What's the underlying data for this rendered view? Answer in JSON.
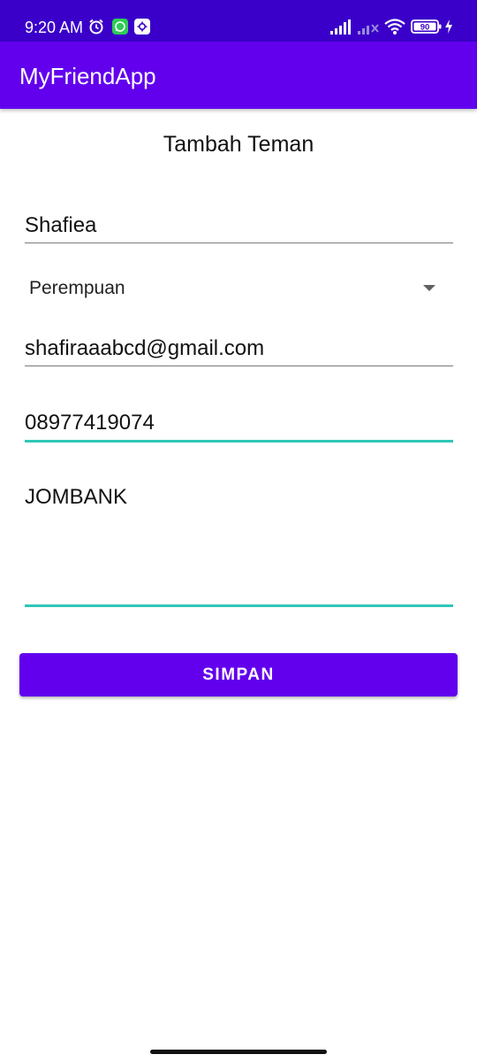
{
  "status_bar": {
    "time": "9:20 AM",
    "battery_level": "90",
    "icons": [
      "alarm-icon",
      "whatsapp-icon",
      "app-notification-icon",
      "signal-icon",
      "signal-no-service-icon",
      "wifi-icon",
      "battery-icon",
      "charging-icon"
    ]
  },
  "app_bar": {
    "title": "MyFriendApp"
  },
  "form": {
    "title": "Tambah Teman",
    "name_value": "Shafiea",
    "gender_selected": "Perempuan",
    "email_value": "shafiraaabcd@gmail.com",
    "phone_value": "08977419074",
    "address_value": "JOMBANK",
    "save_label": "SIMPAN"
  },
  "colors": {
    "status_bar": "#3a00c9",
    "primary": "#6200ee",
    "focus_accent": "#2ec7b7",
    "underline": "#7a7a7a"
  }
}
